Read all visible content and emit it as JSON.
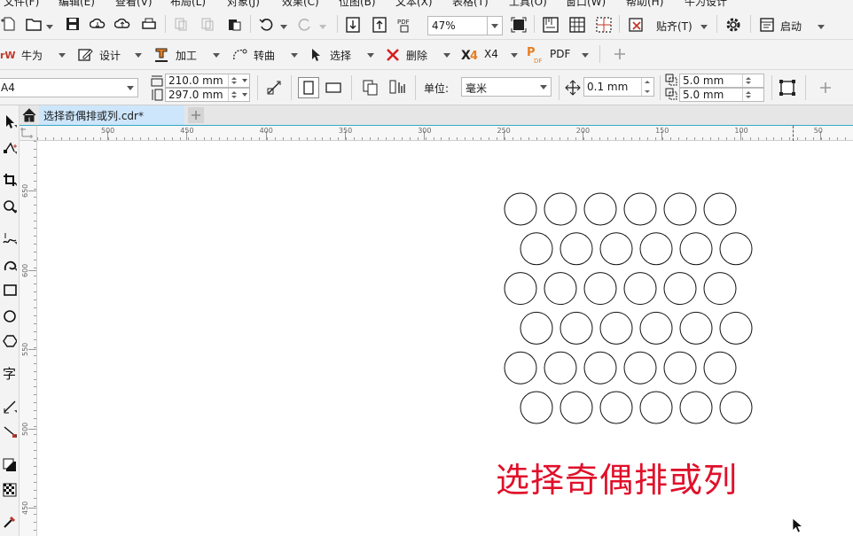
{
  "menu": [
    "文件(F)",
    "编辑(E)",
    "查看(V)",
    "布局(L)",
    "对象(J)",
    "效果(C)",
    "位图(B)",
    "文本(X)",
    "表格(T)",
    "工具(O)",
    "窗口(W)",
    "帮助(H)",
    "牛为设计"
  ],
  "toolbar1": {
    "zoom_value": "47%",
    "snap_label": "贴齐(T)",
    "launch_label": "启动"
  },
  "toolbar2": {
    "brand": "牛为",
    "design": "设计",
    "process": "加工",
    "convert": "转曲",
    "select": "选择",
    "delete": "删除",
    "x4": "X4",
    "pdf": "PDF"
  },
  "propbar": {
    "page_size": "A4",
    "width": "210.0 mm",
    "height": "297.0 mm",
    "unit_label": "单位:",
    "unit_value": "毫米",
    "nudge": "0.1 mm",
    "dup_x": "5.0 mm",
    "dup_y": "5.0 mm"
  },
  "document_tab": "选择奇偶排或列.cdr*",
  "ruler": {
    "h_labels": [
      "500",
      "450",
      "400",
      "350",
      "300",
      "250",
      "200",
      "150",
      "100",
      "50"
    ],
    "v_labels": [
      "650",
      "600",
      "550",
      "500",
      "450"
    ]
  },
  "canvas": {
    "caption": "选择奇偶排或列",
    "caption_color": "#e0102a",
    "rows": [
      {
        "row": 1,
        "circles": 6
      },
      {
        "row": 2,
        "circles": 6
      },
      {
        "row": 3,
        "circles": 6
      },
      {
        "row": 4,
        "circles": 6
      },
      {
        "row": 5,
        "circles": 6
      },
      {
        "row": 6,
        "circles": 6
      }
    ]
  }
}
